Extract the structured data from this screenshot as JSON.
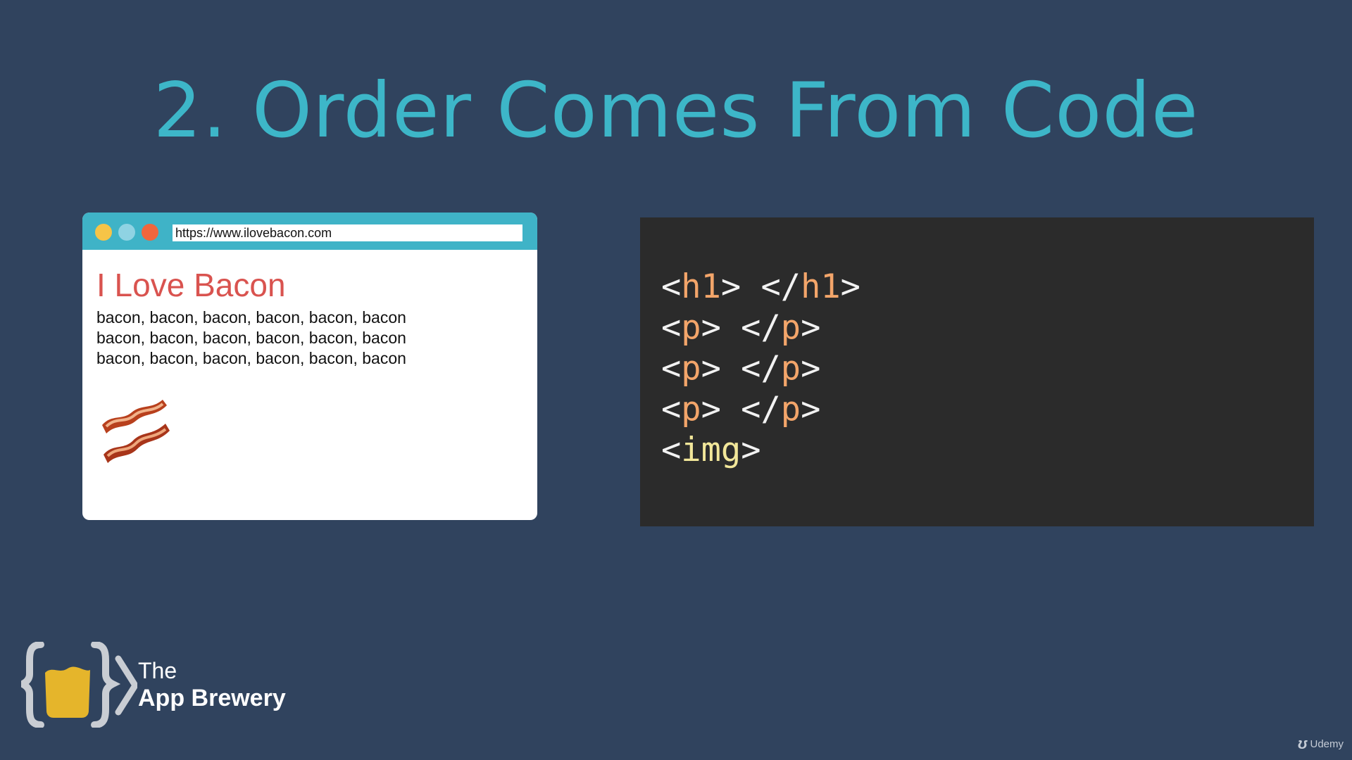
{
  "slide": {
    "title": "2. Order Comes From Code",
    "title_color": "#3db6c8",
    "background": "#30435e"
  },
  "browser": {
    "url": "https://www.ilovebacon.com",
    "dots": [
      "#f6c447",
      "#8fd3e3",
      "#f0663d"
    ],
    "bar_color": "#3fb3c7",
    "heading": "I Love Bacon",
    "heading_color": "#d9534f",
    "paragraphs": [
      "bacon, bacon, bacon, bacon, bacon, bacon",
      "bacon, bacon, bacon, bacon, bacon, bacon",
      "bacon, bacon, bacon, bacon, bacon, bacon"
    ],
    "image_icon": "bacon-image"
  },
  "code": {
    "background": "#2b2b2b",
    "bracket_color": "#f2f2f2",
    "tag_color": "#f3a56a",
    "img_tag_color": "#f2e79a",
    "lines": [
      {
        "open": "h1",
        "close": "h1"
      },
      {
        "open": "p",
        "close": "p"
      },
      {
        "open": "p",
        "close": "p"
      },
      {
        "open": "p",
        "close": "p"
      },
      {
        "open": "img",
        "close": null
      }
    ]
  },
  "logo": {
    "line1": "The",
    "line2": "App Brewery"
  },
  "watermark": {
    "text": "Udemy"
  }
}
